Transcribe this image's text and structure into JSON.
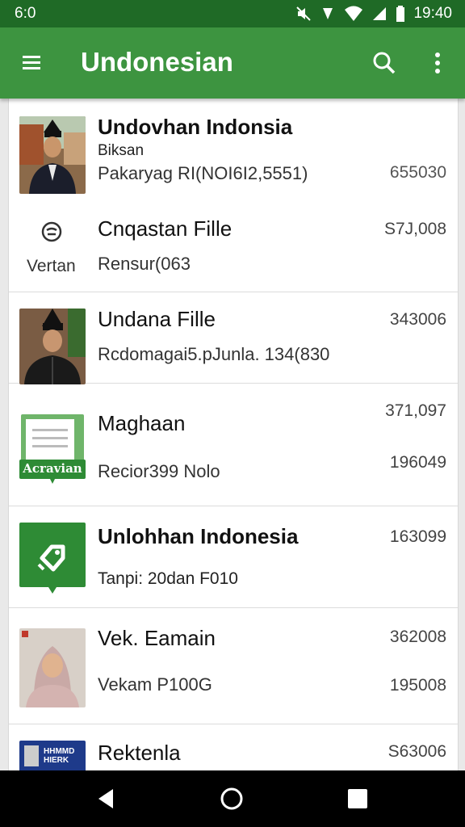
{
  "status": {
    "time": "6:0",
    "clock": "19:40"
  },
  "appbar": {
    "title": "Undonesian"
  },
  "rows": [
    {
      "name": "Undovhan Indonsia",
      "line2": "Biksan",
      "line3": "Pakaryag RI(NOI6I2,5551)",
      "value": "655030"
    },
    {
      "name": "Cnqastan Fille",
      "left_label": "Vertan",
      "line3": "Rensur(063",
      "value": "S7J,008"
    },
    {
      "name": "Undana Fille",
      "line3": "Rcdomagai5.pJunla. 134(830",
      "value": "343006"
    },
    {
      "name": "Maghaan",
      "thumb_label": "Acravian",
      "line3": "Recior399 Nolo",
      "value": "371,097",
      "value2": "196049"
    },
    {
      "name": "Unlohhan Indonesia",
      "line3": "Tanpi: 20dan F010",
      "value": "163099"
    },
    {
      "name": "Vek. Eamain",
      "line3": "Vekam P100G",
      "value": "362008",
      "value2": "195008"
    },
    {
      "name": "Rektenla",
      "thumb_text": "HHMMD HIERK",
      "value": "S63006"
    }
  ],
  "colors": {
    "appbar": "#3d9440",
    "statusbar": "#1f6a26",
    "accent": "#2e8b35"
  }
}
